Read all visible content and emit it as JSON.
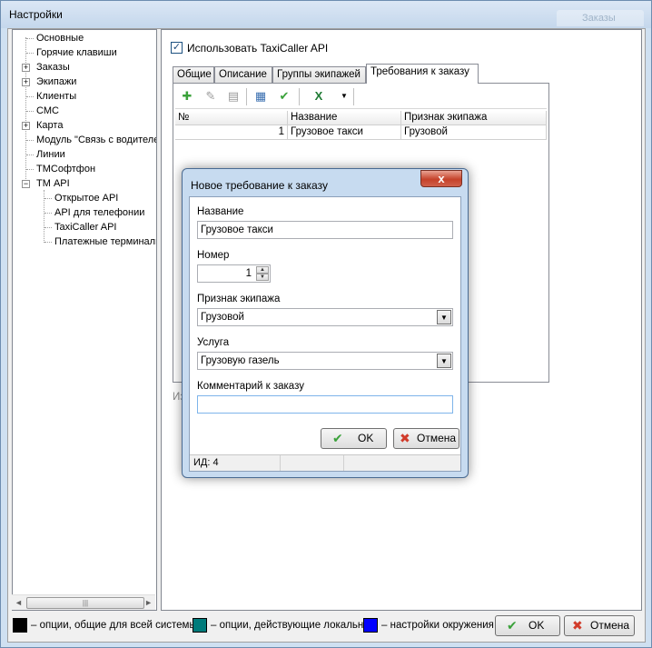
{
  "window": {
    "title": "Настройки",
    "ghost_tab": "Заказы"
  },
  "tree": {
    "items": [
      {
        "label": "Основные"
      },
      {
        "label": "Горячие клавиши"
      },
      {
        "label": "Заказы",
        "expander": "+"
      },
      {
        "label": "Экипажи",
        "expander": "+"
      },
      {
        "label": "Клиенты"
      },
      {
        "label": "СМС"
      },
      {
        "label": "Карта",
        "expander": "+"
      },
      {
        "label": "Модуль \"Связь с водителем\""
      },
      {
        "label": "Линии"
      },
      {
        "label": "ТМСофтфон"
      },
      {
        "label": "ТМ API",
        "expander": "−"
      },
      {
        "label": "Открытое API"
      },
      {
        "label": "API для телефонии"
      },
      {
        "label": "TaxiCaller API"
      },
      {
        "label": "Платежные терминалы"
      }
    ]
  },
  "main": {
    "use_api_label": "Использовать TaxiCaller API",
    "use_api_checked": true,
    "check_mark": "✓",
    "tabs": [
      {
        "label": "Общие"
      },
      {
        "label": "Описание"
      },
      {
        "label": "Группы экипажей"
      },
      {
        "label": "Требования к заказу",
        "active": true
      }
    ],
    "grid": {
      "columns": [
        "№",
        "Название",
        "Признак экипажа"
      ],
      "rows": [
        {
          "num": "1",
          "name": "Грузовое такси",
          "sign": "Грузовой"
        }
      ]
    },
    "truncated_label": "Из"
  },
  "dialog": {
    "title": "Новое требование к заказу",
    "close_glyph": "x",
    "name_label": "Название",
    "name_value": "Грузовое такси",
    "number_label": "Номер",
    "number_value": "1",
    "sign_label": "Признак экипажа",
    "sign_value": "Грузовой",
    "service_label": "Услуга",
    "service_value": "Грузовую газель",
    "comment_label": "Комментарий к заказу",
    "comment_value": "",
    "ok_label": "OK",
    "cancel_label": "Отмена",
    "status_id": "ИД: 4"
  },
  "footer": {
    "legend": [
      {
        "color": "#000000",
        "text": "– опции, общие для всей системы"
      },
      {
        "color": "#007b7b",
        "text": "– опции, действующие локально"
      },
      {
        "color": "#0000ff",
        "text": "– настройки окружения"
      }
    ],
    "ok_label": "OK",
    "cancel_label": "Отмена"
  },
  "icons": {
    "ok": "✔",
    "cancel": "✖",
    "dropdown": "▼",
    "spin_up": "▲",
    "spin_down": "▼",
    "scroll_left": "◄",
    "scroll_right": "►",
    "scroll_grip": "|||"
  }
}
